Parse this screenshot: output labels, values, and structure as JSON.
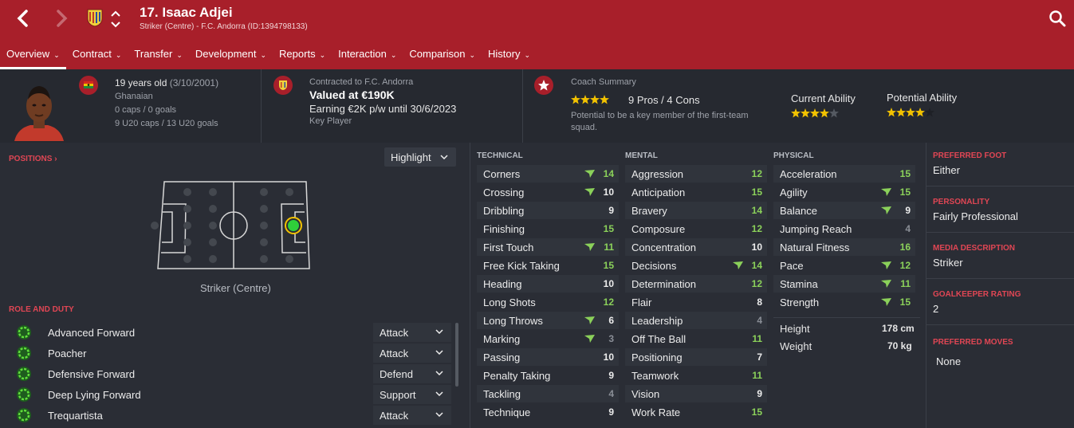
{
  "header": {
    "title": "17. Isaac Adjei",
    "subtitle": "Striker (Centre) - F.C. Andorra (ID:1394798133)",
    "colors": {
      "accent": "#a81f2a",
      "attr_good": "#8bd15a",
      "star": "#f2c200"
    }
  },
  "tabs": [
    {
      "label": "Overview"
    },
    {
      "label": "Contract"
    },
    {
      "label": "Transfer"
    },
    {
      "label": "Development"
    },
    {
      "label": "Reports"
    },
    {
      "label": "Interaction"
    },
    {
      "label": "Comparison"
    },
    {
      "label": "History"
    }
  ],
  "info": {
    "age": "19 years old",
    "dob": "(3/10/2001)",
    "nationality": "Ghanaian",
    "caps": "0 caps / 0 goals",
    "u20": "9 U20 caps / 13 U20 goals",
    "contract_label": "Contracted to F.C. Andorra",
    "value": "Valued at €190K",
    "earning": "Earning €2K p/w until 30/6/2023",
    "status": "Key Player",
    "coach_label": "Coach Summary",
    "pros_cons": "9 Pros / 4 Cons",
    "coach_text_1": "Potential to be a key member of the first-team",
    "coach_text_2": "squad.",
    "coach_stars": 4,
    "current_ability_label": "Current Ability",
    "current_ability_stars": 4,
    "potential_ability_label": "Potential Ability",
    "potential_ability_stars": 4
  },
  "positions": {
    "title": "POSITIONS",
    "highlight": "Highlight",
    "position_label": "Striker (Centre)"
  },
  "roles": {
    "title": "ROLE AND DUTY",
    "items": [
      {
        "name": "Advanced Forward",
        "duty": "Attack"
      },
      {
        "name": "Poacher",
        "duty": "Attack"
      },
      {
        "name": "Defensive Forward",
        "duty": "Defend"
      },
      {
        "name": "Deep Lying Forward",
        "duty": "Support"
      },
      {
        "name": "Trequartista",
        "duty": "Attack"
      }
    ]
  },
  "technical": {
    "title": "TECHNICAL",
    "attrs": [
      {
        "name": "Corners",
        "value": "14",
        "arrow": true
      },
      {
        "name": "Crossing",
        "value": "10",
        "arrow": true
      },
      {
        "name": "Dribbling",
        "value": "9",
        "arrow": false
      },
      {
        "name": "Finishing",
        "value": "15",
        "arrow": false
      },
      {
        "name": "First Touch",
        "value": "11",
        "arrow": true
      },
      {
        "name": "Free Kick Taking",
        "value": "15",
        "arrow": false
      },
      {
        "name": "Heading",
        "value": "10",
        "arrow": false
      },
      {
        "name": "Long Shots",
        "value": "12",
        "arrow": false
      },
      {
        "name": "Long Throws",
        "value": "6",
        "arrow": true
      },
      {
        "name": "Marking",
        "value": "3",
        "arrow": true
      },
      {
        "name": "Passing",
        "value": "10",
        "arrow": false
      },
      {
        "name": "Penalty Taking",
        "value": "9",
        "arrow": false
      },
      {
        "name": "Tackling",
        "value": "4",
        "arrow": false
      },
      {
        "name": "Technique",
        "value": "9",
        "arrow": false
      }
    ]
  },
  "mental": {
    "title": "MENTAL",
    "attrs": [
      {
        "name": "Aggression",
        "value": "12",
        "arrow": false
      },
      {
        "name": "Anticipation",
        "value": "15",
        "arrow": false
      },
      {
        "name": "Bravery",
        "value": "14",
        "arrow": false
      },
      {
        "name": "Composure",
        "value": "12",
        "arrow": false
      },
      {
        "name": "Concentration",
        "value": "10",
        "arrow": false
      },
      {
        "name": "Decisions",
        "value": "14",
        "arrow": true
      },
      {
        "name": "Determination",
        "value": "12",
        "arrow": false
      },
      {
        "name": "Flair",
        "value": "8",
        "arrow": false
      },
      {
        "name": "Leadership",
        "value": "4",
        "arrow": false
      },
      {
        "name": "Off The Ball",
        "value": "11",
        "arrow": false
      },
      {
        "name": "Positioning",
        "value": "7",
        "arrow": false
      },
      {
        "name": "Teamwork",
        "value": "11",
        "arrow": false
      },
      {
        "name": "Vision",
        "value": "9",
        "arrow": false
      },
      {
        "name": "Work Rate",
        "value": "15",
        "arrow": false
      }
    ]
  },
  "physical": {
    "title": "PHYSICAL",
    "attrs": [
      {
        "name": "Acceleration",
        "value": "15",
        "arrow": false
      },
      {
        "name": "Agility",
        "value": "15",
        "arrow": true
      },
      {
        "name": "Balance",
        "value": "9",
        "arrow": true
      },
      {
        "name": "Jumping Reach",
        "value": "4",
        "arrow": false
      },
      {
        "name": "Natural Fitness",
        "value": "16",
        "arrow": false
      },
      {
        "name": "Pace",
        "value": "12",
        "arrow": true
      },
      {
        "name": "Stamina",
        "value": "11",
        "arrow": true
      },
      {
        "name": "Strength",
        "value": "15",
        "arrow": true
      }
    ],
    "height_label": "Height",
    "height": "178 cm",
    "weight_label": "Weight",
    "weight": "70 kg"
  },
  "side": {
    "foot_label": "PREFERRED FOOT",
    "foot": "Either",
    "personality_label": "PERSONALITY",
    "personality": "Fairly Professional",
    "media_label": "MEDIA DESCRIPTION",
    "media": "Striker",
    "gk_label": "GOALKEEPER RATING",
    "gk": "2",
    "moves_label": "PREFERRED MOVES",
    "moves": "None"
  }
}
